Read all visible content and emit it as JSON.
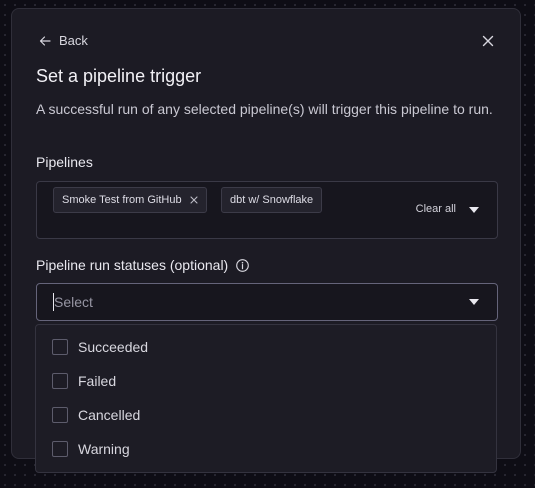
{
  "modal": {
    "back_label": "Back",
    "title": "Set a pipeline trigger",
    "description": "A successful run of any selected pipeline(s) will trigger this pipeline to run."
  },
  "pipelines": {
    "label": "Pipelines",
    "chips": [
      "Smoke Test from GitHub",
      "dbt w/ Snowflake"
    ],
    "clear_label": "Clear all"
  },
  "statuses": {
    "label": "Pipeline run statuses (optional)",
    "placeholder": "Select",
    "options": [
      "Succeeded",
      "Failed",
      "Cancelled",
      "Warning"
    ]
  },
  "icons": {
    "back": "arrow-left-icon",
    "close": "close-icon",
    "info": "info-icon",
    "caret": "chevron-down-icon",
    "chip_remove": "close-icon"
  },
  "colors": {
    "modal_bg": "#1c1b24",
    "page_bg": "#0e0d15",
    "text": "#f2f1f6",
    "border_focus": "#65647a"
  }
}
